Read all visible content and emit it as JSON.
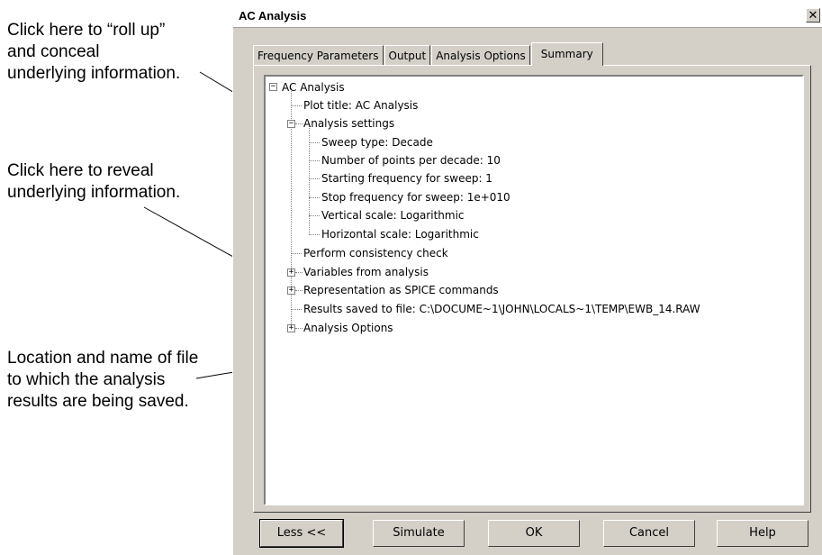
{
  "annotations": {
    "rollup": "Click here to “roll up”\nand conceal\nunderlying information.",
    "reveal": "Click here to reveal\nunderlying information.",
    "location": "Location and name of file\nto which the analysis\nresults are being saved."
  },
  "window": {
    "title": "AC Analysis",
    "close_glyph": "✕"
  },
  "tabs": [
    "Frequency Parameters",
    "Output",
    "Analysis Options",
    "Summary"
  ],
  "tree": {
    "root": "AC Analysis",
    "plot_title": "Plot title: AC Analysis",
    "analysis_settings": "Analysis settings",
    "settings_children": [
      "Sweep type: Decade",
      "Number of points per decade: 10",
      "Starting frequency for sweep: 1",
      "Stop frequency for sweep: 1e+010",
      "Vertical scale: Logarithmic",
      "Horizontal scale: Logarithmic"
    ],
    "consistency": "Perform consistency check",
    "variables": "Variables from analysis",
    "spice": "Representation as SPICE commands",
    "results": "Results saved to file: C:\\DOCUME~1\\JOHN\\LOCALS~1\\TEMP\\EWB_14.RAW",
    "analysis_options": "Analysis Options",
    "collapse_glyph": "−",
    "expand_glyph": "+"
  },
  "buttons": {
    "less": "Less <<",
    "simulate": "Simulate",
    "ok": "OK",
    "cancel": "Cancel",
    "help": "Help"
  }
}
